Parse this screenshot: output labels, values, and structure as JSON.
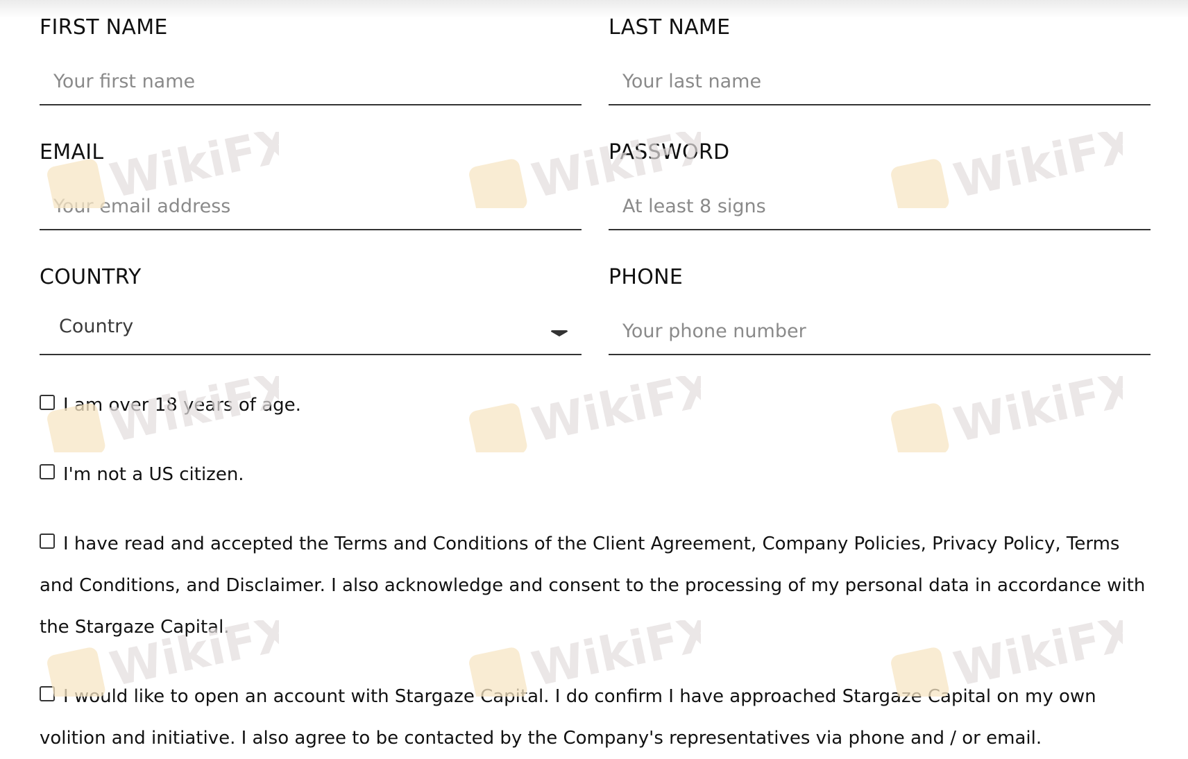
{
  "form": {
    "fields": {
      "first_name": {
        "label": "FIRST NAME",
        "placeholder": "Your first name"
      },
      "last_name": {
        "label": "LAST NAME",
        "placeholder": "Your last name"
      },
      "email": {
        "label": "EMAIL",
        "placeholder": "Your email address"
      },
      "password": {
        "label": "PASSWORD",
        "placeholder": "At least 8 signs"
      },
      "country": {
        "label": "COUNTRY",
        "selected": "Country",
        "icon": "caret-down-icon"
      },
      "phone": {
        "label": "PHONE",
        "placeholder": "Your phone number"
      }
    },
    "checkboxes": {
      "age": {
        "label": "I am over 18 years of age.",
        "checked": false
      },
      "us_citizen": {
        "label": "I'm not a US citizen.",
        "checked": false
      },
      "terms": {
        "label": "I have read and accepted the Terms and Conditions of the Client Agreement, Company Policies, Privacy Policy, Terms and Conditions, and Disclaimer. I also acknowledge and consent to the processing of my personal data in accordance with the Stargaze Capital.",
        "checked": false
      },
      "own_volition": {
        "label": "I would like to open an account with Stargaze Capital. I do confirm I have approached Stargaze Capital on my own volition and initiative. I also agree to be contacted by the Company's representatives via phone and / or email.",
        "checked": false
      }
    }
  },
  "watermark": {
    "text": "WikiFX",
    "icon": "eagle-logo-icon",
    "text_color": "#e3dede",
    "logo_color": "#f7e6c4"
  }
}
